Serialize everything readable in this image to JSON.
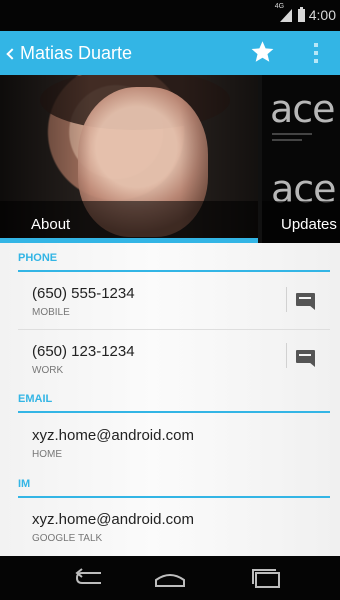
{
  "status_bar": {
    "network_type": "4G",
    "time": "4:00",
    "icons": [
      "signal-icon",
      "battery-icon"
    ]
  },
  "action_bar": {
    "title": "Matias Duarte",
    "icons": [
      "back-chevron-icon",
      "star-icon",
      "overflow-menu-icon"
    ]
  },
  "tabs": [
    {
      "label": "About",
      "selected": true
    },
    {
      "label": "Updates",
      "selected": false
    }
  ],
  "updates_preview": {
    "logo_text_top": "ace",
    "logo_text_bottom": "ace"
  },
  "sections": {
    "phone": {
      "header": "PHONE",
      "items": [
        {
          "value": "(650) 555-1234",
          "type": "MOBILE",
          "action_icon": "message-icon"
        },
        {
          "value": "(650) 123-1234",
          "type": "WORK",
          "action_icon": "message-icon"
        }
      ]
    },
    "email": {
      "header": "EMAIL",
      "items": [
        {
          "value": "xyz.home@android.com",
          "type": "HOME"
        }
      ]
    },
    "im": {
      "header": "IM",
      "items": [
        {
          "value": "xyz.home@android.com",
          "type": "GOOGLE TALK"
        }
      ]
    }
  },
  "navigation_bar": {
    "buttons": [
      "back-icon",
      "home-icon",
      "recent-apps-icon"
    ]
  },
  "colors": {
    "accent": "#33b5e5",
    "status_bar": "#050505",
    "navigation_bar": "#050505",
    "content_background": "#f4f4f4"
  }
}
